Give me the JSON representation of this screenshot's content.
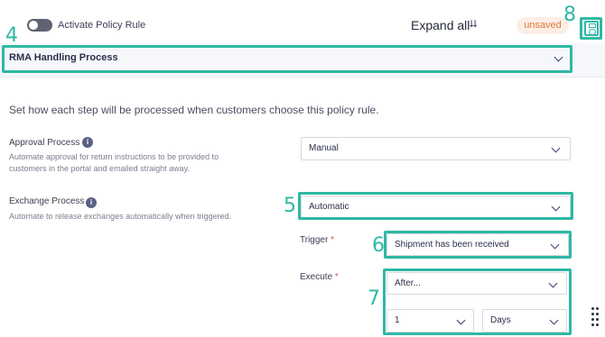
{
  "top_bar": {
    "toggle_label": "Activate Policy Rule",
    "expand_all_label": "Expand all",
    "status_badge": "unsaved"
  },
  "section": {
    "title": "RMA Handling Process"
  },
  "intro_text": "Set how each step will be processed when customers choose this policy rule.",
  "approval": {
    "label": "Approval Process",
    "description": "Automate approval for return instructions to be provided to customers in the portal and emailed straight away.",
    "selected": "Manual"
  },
  "exchange": {
    "label": "Exchange Process",
    "description": "Automate to release exchanges automatically when triggered.",
    "selected": "Automatic",
    "trigger_label": "Trigger",
    "trigger_selected": "Shipment has been received",
    "execute_label": "Execute",
    "execute_selected": "After...",
    "quantity_selected": "1",
    "unit_selected": "Days"
  },
  "annotations": {
    "n4": "4",
    "n5": "5",
    "n6": "6",
    "n7": "7",
    "n8": "8"
  },
  "colors": {
    "annotation": "#2fb8a5",
    "badge_bg": "#fdeee5",
    "badge_text": "#d87a3a",
    "header_bg": "#f6f7fb",
    "info_icon": "#5b6184"
  }
}
